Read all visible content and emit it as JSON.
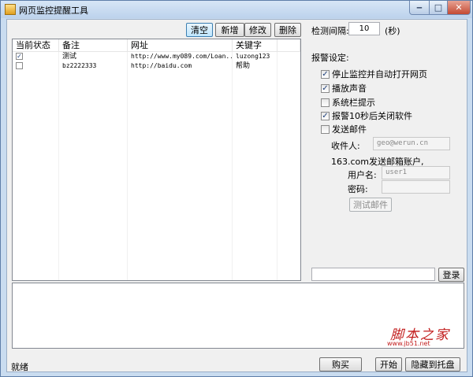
{
  "window": {
    "title": "网页监控提醒工具"
  },
  "toolbar": {
    "clear": "清空",
    "add": "新增",
    "edit": "修改",
    "delete": "删除"
  },
  "table": {
    "headers": [
      "当前状态",
      "备注",
      "网址",
      "关键字"
    ],
    "rows": [
      {
        "checked": true,
        "note": "测试",
        "url": "http://www.my089.com/Loan...",
        "keyword": "luzong123"
      },
      {
        "checked": false,
        "note": "bz2222333",
        "url": "http://baidu.com",
        "keyword": "帮助"
      }
    ]
  },
  "interval": {
    "label": "检测间隔:",
    "value": "10",
    "unit": "(秒)"
  },
  "alarm": {
    "section_label": "报警设定:",
    "options": [
      {
        "label": "停止监控并自动打开网页",
        "checked": true
      },
      {
        "label": "播放声音",
        "checked": true
      },
      {
        "label": "系统栏提示",
        "checked": false
      },
      {
        "label": "报警10秒后关闭软件",
        "checked": true
      },
      {
        "label": "发送邮件",
        "checked": false
      }
    ]
  },
  "email": {
    "recipient_label": "收件人:",
    "recipient_value": "geo@werun.cn",
    "sender_label": "163.com发送邮箱账户,",
    "username_label": "用户名:",
    "username_value": "user1",
    "password_label": "密码:",
    "password_value": "",
    "test_button": "测试邮件"
  },
  "login": {
    "input_value": "",
    "button": "登录"
  },
  "footer": {
    "status": "就绪",
    "buy": "购买",
    "start": "开始",
    "hide": "隐藏到托盘"
  },
  "watermark": {
    "text": "脚本之家",
    "url": "www.jb51.net"
  }
}
